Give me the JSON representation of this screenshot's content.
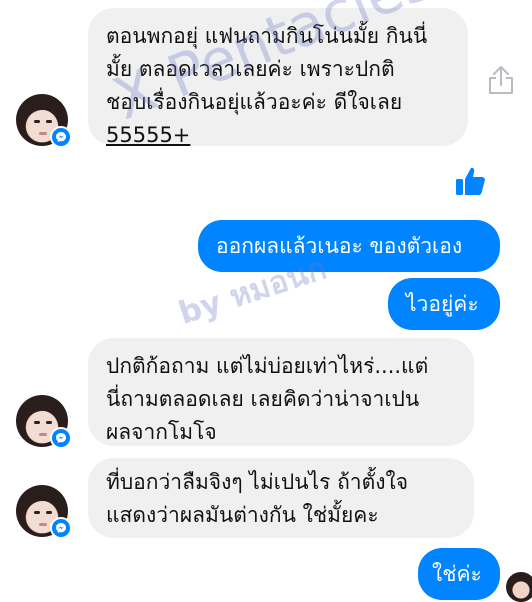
{
  "messages": [
    {
      "sender": "other",
      "lines": [
        "ตอนพกอยุ่ แฟนถามกินโน่นมั้ย กินนี่",
        "มั้ย ตลอดเวลาเลยค่ะ เพราะปกติ",
        "ชอบเรื่องกินอยุ่แล้วอะค่ะ ดีใจเลย",
        "55555+"
      ]
    },
    {
      "sender": "me",
      "text": "ออกผลแล้วเนอะ ของตัวเอง"
    },
    {
      "sender": "me",
      "text": "ไวอยู่ค่ะ"
    },
    {
      "sender": "other",
      "lines": [
        "ปกติก้อถาม แต่ไม่บ่อยเท่าไหร่....แต่",
        "นี่ถามตลอดเลย  เลยคิดว่าน่าจาเปน",
        "ผลจากโมโจ"
      ]
    },
    {
      "sender": "other",
      "lines": [
        "ที่บอกว่าลืมจิงๆ ไม่เปนไร ถ้าตั้งใจ",
        "แสดงว่าผลมันต่างกัน ใช่มั้ยคะ"
      ]
    },
    {
      "sender": "me",
      "text": "ใช่ค่ะ"
    }
  ],
  "watermark": {
    "line1": "X Pentacles",
    "line2": "by หมอนก"
  },
  "icons": {
    "share": "share-icon",
    "like": "thumbs-up-icon",
    "messenger_badge": "messenger-icon"
  },
  "colors": {
    "outgoing_bubble": "#0084ff",
    "incoming_bubble": "#f1f0f0",
    "accent": "#0084ff"
  }
}
